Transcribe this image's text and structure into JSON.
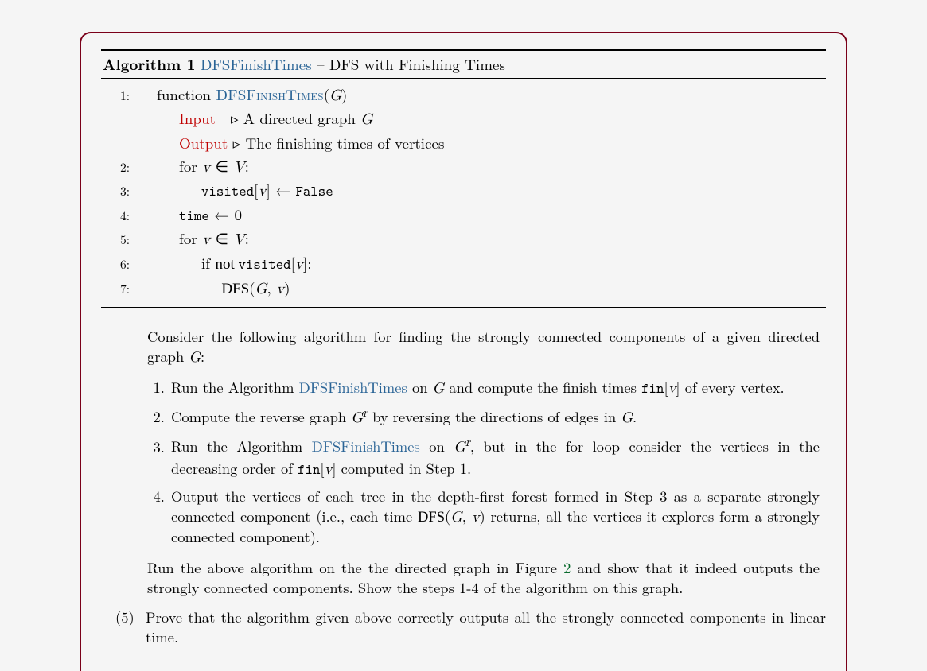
{
  "algorithm": {
    "label": "Algorithm 1",
    "name": "DFSFinishTimes",
    "subtitle": " – DFS with Finishing Times",
    "lines": {
      "l1_pre": "function ",
      "l1_name": "DFSFinishTimes",
      "l1_arg_open": "(",
      "l1_arg": "G",
      "l1_arg_close": ")",
      "input_label": "Input",
      "tri": "▹",
      "input_text": " A directed graph ",
      "input_var": "G",
      "output_label": "Output",
      "output_text": " The finishing times of vertices",
      "l2_for": "for ",
      "l2_expr_v": "v",
      "l2_expr_in": " ∈ ",
      "l2_expr_V": "V",
      "l2_colon": ":",
      "l3_vis": "visited",
      "l3_open": "[",
      "l3_v": "v",
      "l3_close": "]",
      "l3_assign": " ← ",
      "l3_false": "False",
      "l4_time": "time",
      "l4_assign": " ← ",
      "l4_zero": "0",
      "l5_for": "for ",
      "l5_v": "v",
      "l5_in": " ∈ ",
      "l5_V": "V",
      "l5_colon": ":",
      "l6_if": "if ",
      "l6_not": "not ",
      "l6_vis": "visited",
      "l6_open": "[",
      "l6_v": "v",
      "l6_close": "]",
      "l6_colon": ":",
      "l7_dfs": "DFS",
      "l7_open": "(",
      "l7_G": "G",
      "l7_comma": ", ",
      "l7_v": "v",
      "l7_close": ")"
    }
  },
  "narrative": {
    "intro_a": "Consider the following algorithm for finding the strongly connected components of a given directed graph ",
    "intro_G": "G",
    "intro_b": ":",
    "steps": {
      "s1a": "Run the Algorithm ",
      "s1link": "DFSFinishTimes",
      "s1b": " on ",
      "s1G": "G",
      "s1c": " and compute the finish times ",
      "s1fin": "fin",
      "s1br_open": "[",
      "s1v": "v",
      "s1br_close": "]",
      "s1d": " of every vertex.",
      "s2a": "Compute the reverse graph ",
      "s2Gr_G": "G",
      "s2Gr_r": "r",
      "s2b": " by reversing the directions of edges in ",
      "s2G": "G",
      "s2c": ".",
      "s3a": "Run the Algorithm ",
      "s3link": "DFSFinishTimes",
      "s3b": " on ",
      "s3Gr_G": "G",
      "s3Gr_r": "r",
      "s3c": ", but in the for loop consider the vertices in the decreasing order of ",
      "s3fin": "fin",
      "s3br_open": "[",
      "s3v": "v",
      "s3br_close": "]",
      "s3d": " computed in Step 1.",
      "s4a": "Output the vertices of each tree in the depth-first forest formed in Step 3 as a separate strongly connected component (i.e., each time ",
      "s4dfs": "DFS",
      "s4open": "(",
      "s4G": "G",
      "s4comma": ", ",
      "s4v": "v",
      "s4close": ")",
      "s4b": " returns, all the vertices it explores form a strongly connected component)."
    },
    "tail_a": "Run the above algorithm on the the directed graph in Figure ",
    "tail_fig": "2",
    "tail_b": " and show that it indeed outputs the strongly connected components. Show the steps 1-4 of the algorithm on this graph.",
    "q5_num": "(5)",
    "q5_text": "Prove that the algorithm given above correctly outputs all the strongly connected components in linear time."
  }
}
